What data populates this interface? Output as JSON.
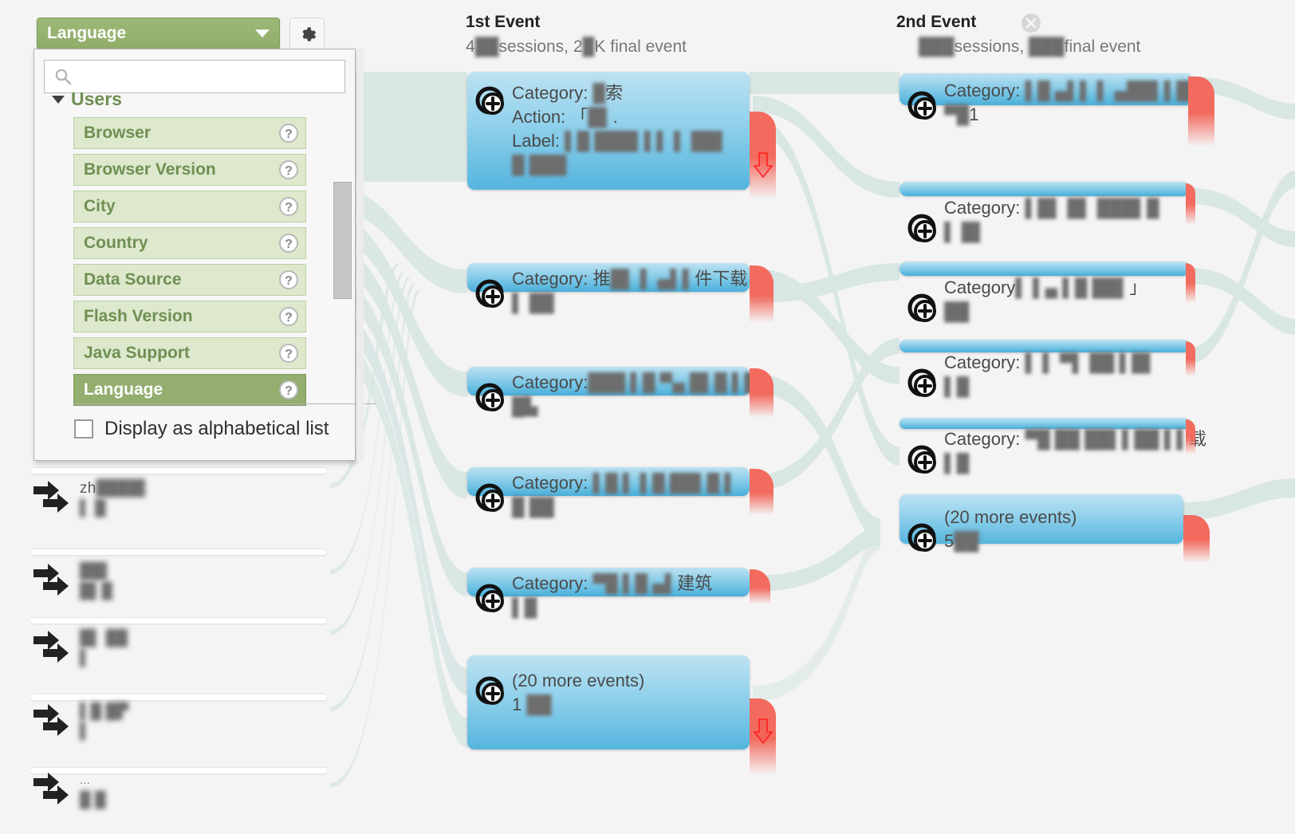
{
  "dimension_selector": {
    "button_label": "Language",
    "caret_icon": "chevron-down-icon",
    "gear_icon": "gear-icon",
    "search_placeholder": "",
    "search_value": "",
    "search_icon": "search-icon",
    "group_label": "Users",
    "group_toggle_icon": "triangle-down-icon",
    "items": [
      {
        "label": "Browser",
        "selected": false,
        "help_icon": "question-mark-icon"
      },
      {
        "label": "Browser Version",
        "selected": false,
        "help_icon": "question-mark-icon"
      },
      {
        "label": "City",
        "selected": false,
        "help_icon": "question-mark-icon"
      },
      {
        "label": "Country",
        "selected": false,
        "help_icon": "question-mark-icon"
      },
      {
        "label": "Data Source",
        "selected": false,
        "help_icon": "question-mark-icon"
      },
      {
        "label": "Flash Version",
        "selected": false,
        "help_icon": "question-mark-icon"
      },
      {
        "label": "Java Support",
        "selected": false,
        "help_icon": "question-mark-icon"
      },
      {
        "label": "Language",
        "selected": true,
        "help_icon": "question-mark-icon"
      }
    ],
    "alphabetical_label": "Display as alphabetical list",
    "alphabetical_checked": false
  },
  "sidebar_rows": [
    {
      "icon": "double-arrow-icon",
      "line1": "zh",
      "line2": "",
      "redacted": true
    },
    {
      "icon": "double-arrow-icon",
      "line1": "",
      "line2": "",
      "redacted": true
    },
    {
      "icon": "double-arrow-icon",
      "line1": "",
      "line2": "",
      "redacted": true
    },
    {
      "icon": "double-arrow-icon",
      "line1": "",
      "line2": "",
      "redacted": true
    },
    {
      "icon": "double-arrow-icon",
      "line1": "...",
      "line2": "",
      "redacted": true
    }
  ],
  "columns": [
    {
      "title": "1st Event",
      "subtitle_prefix": "4",
      "subtitle": "4     sessions, 2   K final event",
      "has_close": false,
      "close_icon": "close-circle-icon"
    },
    {
      "title": "2nd Event",
      "subtitle": "      sessions,      final event",
      "has_close": true,
      "close_icon": "close-circle-icon"
    }
  ],
  "column1_nodes": [
    {
      "icon": "expand-node-icon",
      "lines": [
        "Category:  索",
        "Action: ",
        "Label: ",
        ""
      ],
      "is_tall": true,
      "redacted": true
    },
    {
      "icon": "expand-node-icon",
      "lines": [
        "Category: 推      件下载",
        ""
      ],
      "is_tall": false,
      "redacted": true
    },
    {
      "icon": "expand-node-icon",
      "lines": [
        "Category:",
        ""
      ],
      "is_tall": false,
      "redacted": true
    },
    {
      "icon": "expand-node-icon",
      "lines": [
        "Category: ",
        ""
      ],
      "is_tall": false,
      "redacted": true
    },
    {
      "icon": "expand-node-icon",
      "lines": [
        "Category: ",
        ""
      ],
      "is_tall": false,
      "redacted": true
    },
    {
      "icon": "expand-node-icon",
      "lines": [
        "(20 more events)",
        "1"
      ],
      "is_tall": true,
      "redacted": false
    }
  ],
  "column2_nodes": [
    {
      "icon": "expand-node-icon",
      "lines": [
        "Category: ",
        ""
      ],
      "redacted": true
    },
    {
      "icon": "expand-node-icon",
      "lines": [
        "Category: ",
        ""
      ],
      "redacted": true
    },
    {
      "icon": "expand-node-icon",
      "lines": [
        "Category",
        ""
      ],
      "redacted": true
    },
    {
      "icon": "expand-node-icon",
      "lines": [
        "Category: ",
        ""
      ],
      "redacted": true
    },
    {
      "icon": "expand-node-icon",
      "lines": [
        "Category: ",
        ""
      ],
      "redacted": true
    },
    {
      "icon": "expand-node-icon",
      "lines": [
        "(20 more events)",
        "5"
      ],
      "redacted": false
    }
  ],
  "colors": {
    "node_top": "#bde2f2",
    "node_bottom": "#55b5de",
    "dropoff": "#f26b5e",
    "flow": "#d6e4e2",
    "accent_green": "#93ae6f",
    "item_green": "#dde8cd",
    "text_green": "#6f8f52",
    "page_bg": "#f4f4f4"
  },
  "dropoff_arrow_icon": "down-arrow-icon"
}
